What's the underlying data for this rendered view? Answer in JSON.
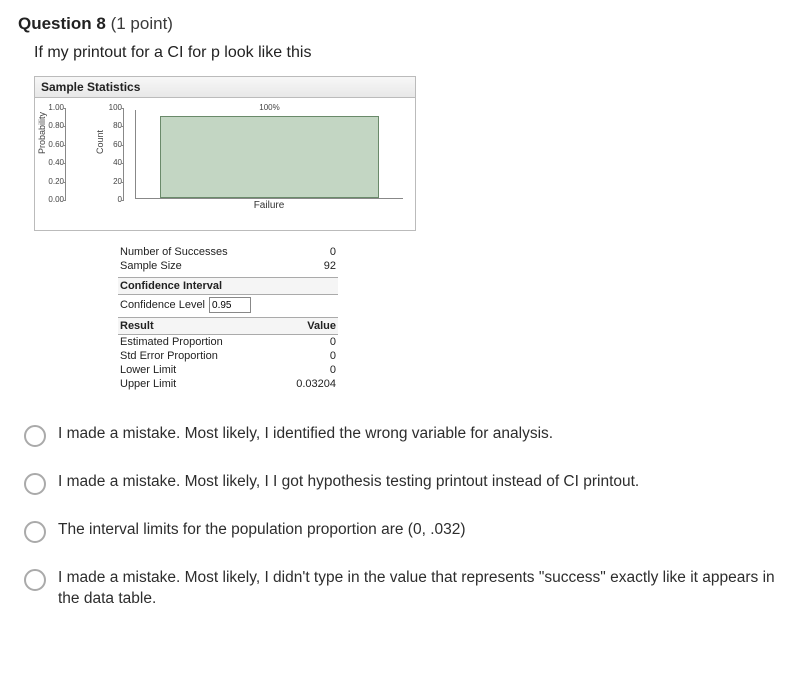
{
  "question": {
    "label": "Question 8",
    "points": "(1 point)",
    "prompt": "If my printout for a CI for p look like this"
  },
  "panel": {
    "title": "Sample Statistics",
    "probability_label": "Probability",
    "count_label": "Count",
    "probability_ticks": [
      "1.00",
      "0.80",
      "0.60",
      "0.40",
      "0.20",
      "0.00"
    ],
    "count_ticks": [
      "100",
      "80",
      "60",
      "40",
      "20",
      "0"
    ],
    "x_category": "Failure",
    "bar_annotation": "100%"
  },
  "chart_data": {
    "type": "bar",
    "categories": [
      "Failure"
    ],
    "values": [
      92
    ],
    "percent_values": [
      100
    ],
    "xlabel": "",
    "ylabel_left": "Probability",
    "ylabel_right": "Count",
    "ylim_probability": [
      0,
      1.0
    ],
    "ylim_count": [
      0,
      100
    ]
  },
  "stats": {
    "num_successes_label": "Number of Successes",
    "num_successes_value": "0",
    "sample_size_label": "Sample Size",
    "sample_size_value": "92",
    "ci_header": "Confidence Interval",
    "conf_level_label": "Confidence Level",
    "conf_level_value": "0.95",
    "result_header": "Result",
    "value_header": "Value",
    "est_prop_label": "Estimated Proportion",
    "est_prop_value": "0",
    "std_err_label": "Std Error Proportion",
    "std_err_value": "0",
    "lower_label": "Lower Limit",
    "lower_value": "0",
    "upper_label": "Upper Limit",
    "upper_value": "0.03204"
  },
  "options": {
    "a": "I made a mistake.  Most likely, I identified the wrong variable for analysis.",
    "b": "I made a mistake.  Most likely, I I got hypothesis testing printout instead of CI printout.",
    "c": "The interval limits for the population proportion are (0, .032)",
    "d": "I made a mistake.  Most likely, I didn't type in the value that represents \"success\" exactly like it appears in the data table."
  }
}
